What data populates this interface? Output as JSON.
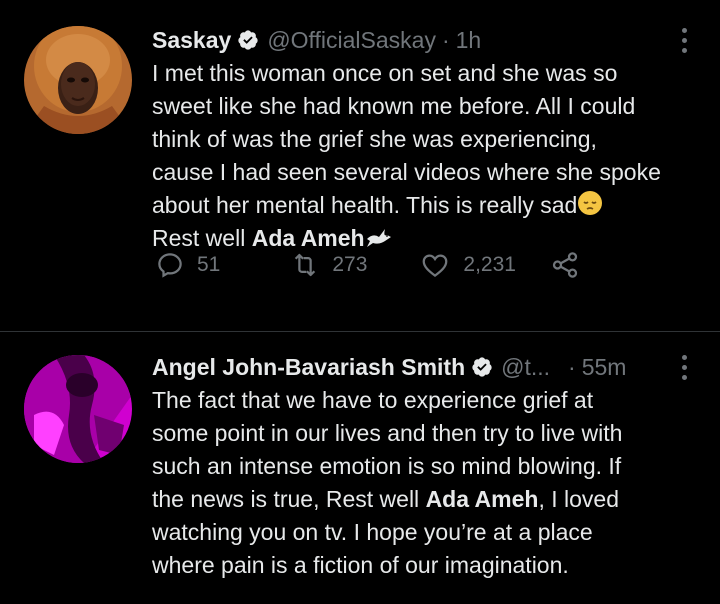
{
  "tweets": [
    {
      "name": "Saskay",
      "handle": "@OfficialSaskay",
      "separator": "·",
      "time": "1h",
      "text": {
        "line1": "I met this woman once on set and she was so",
        "line2": "sweet like she had known me before. All I could",
        "line3": "think of was the grief she was experiencing,",
        "line4": "cause I had seen several videos where she spoke",
        "line5": "about her mental health. This is really sad",
        "line6_prefix": "Rest well ",
        "line6_bold": "Ada Ameh"
      },
      "emojis": [
        "pensive-face-icon",
        "dove-icon"
      ],
      "actions": {
        "replies": "51",
        "retweets": "273",
        "likes": "2,231"
      },
      "avatar_icon": "avatar-woman-headscarf"
    },
    {
      "name": "Angel John-Bavariash Smith",
      "handle": "@t...",
      "separator": "·",
      "time": "55m",
      "text": {
        "line1": "The fact that we have to experience grief at",
        "line2": "some point in our lives and then try to live with",
        "line3": "such an intense emotion is so mind blowing. If",
        "line4_prefix": "the news is true, Rest well ",
        "line4_bold": "Ada Ameh",
        "line4_suffix": ", I loved",
        "line5": "watching you on tv. I hope you’re at a place",
        "line6": "where pain is a fiction of our imagination."
      },
      "avatar_icon": "avatar-magenta-photo"
    }
  ],
  "colors": {
    "background": "#000000",
    "text": "#e7e9ea",
    "muted": "#71767b",
    "divider": "#2f3336",
    "verified": "#e7e9ea"
  }
}
